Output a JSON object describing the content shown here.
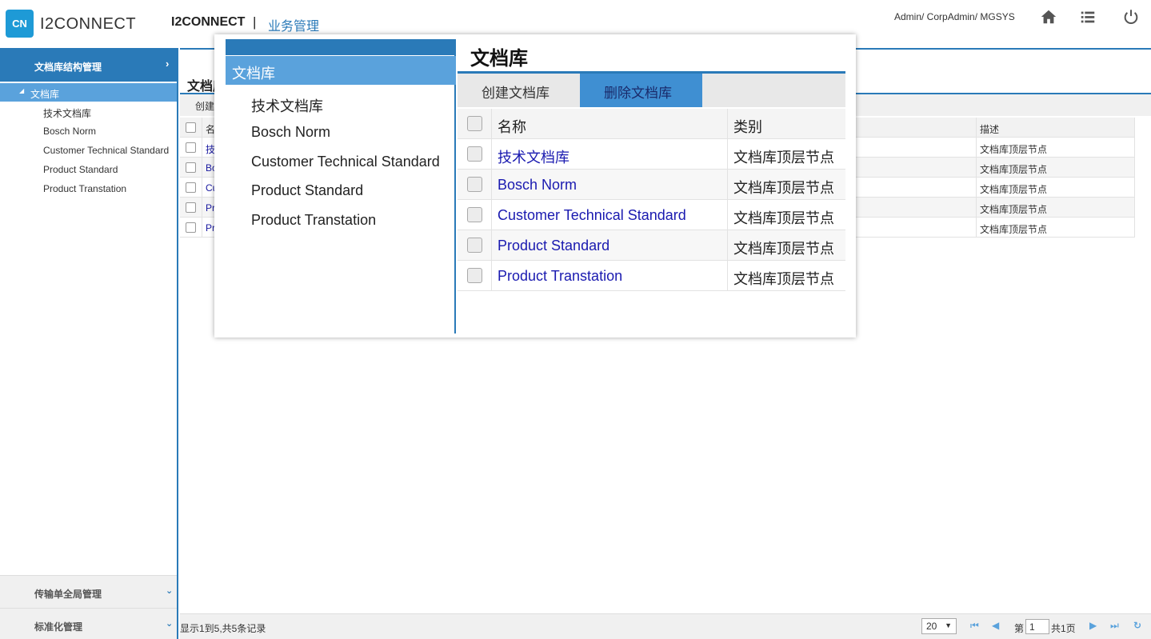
{
  "header": {
    "logo_mark": "CN",
    "logo_text": "I2CONNECT",
    "app_name": "I2CONNECT",
    "separator": "|",
    "app_section": "业务管理",
    "user": "Admin/ CorpAdmin/ MGSYS",
    "icons": [
      "home-icon",
      "list-icon",
      "power-icon"
    ]
  },
  "sidebar": {
    "active_group": "文档库结构管理",
    "tree_root": "文档库",
    "items": [
      "技术文档库",
      "Bosch Norm",
      "Customer Technical Standard",
      "Product Standard",
      "Product Transtation"
    ],
    "footer_groups": [
      "传输单全局管理",
      "标准化管理"
    ]
  },
  "main": {
    "title": "文档库",
    "toolbar_label": "创建",
    "columns": [
      "名称",
      "描述"
    ],
    "rows": [
      {
        "name": "技术文档库",
        "desc": "文档库顶层节点"
      },
      {
        "name": "Bosch Norm",
        "desc": "文档库顶层节点"
      },
      {
        "name": "Customer Technical Standard",
        "desc": "文档库顶层节点"
      },
      {
        "name": "Product Standard",
        "desc": "文档库顶层节点"
      },
      {
        "name": "Product Transtation",
        "desc": "文档库顶层节点"
      }
    ],
    "truncated_names": [
      "名",
      "技",
      "Bo",
      "Cu",
      "Pr",
      "Pr"
    ]
  },
  "pager": {
    "summary": "显示1到5,共5条记录",
    "page_size": "20",
    "page_label_prefix": "第",
    "page_value": "1",
    "page_total": "共1页"
  },
  "zoom": {
    "tree_root": "文档库",
    "tree_items": [
      "技术文档库",
      "Bosch Norm",
      "Customer Technical Standard",
      "Product Standard",
      "Product Transtation"
    ],
    "title": "文档库",
    "create_button": "创建文档库",
    "delete_button": "删除文档库",
    "col_name": "名称",
    "col_type": "类别",
    "rows": [
      {
        "name": "技术文档库",
        "type": "文档库顶层节点"
      },
      {
        "name": "Bosch Norm",
        "type": "文档库顶层节点"
      },
      {
        "name": "Customer Technical Standard",
        "type": "文档库顶层节点"
      },
      {
        "name": "Product Standard",
        "type": "文档库顶层节点"
      },
      {
        "name": "Product Transtation",
        "type": "文档库顶层节点"
      }
    ]
  },
  "colors": {
    "brand_blue": "#2a7ab8",
    "tree_selected": "#5aa2dc",
    "logo_bg": "#1e9ad6",
    "link": "#1a1aa0"
  }
}
